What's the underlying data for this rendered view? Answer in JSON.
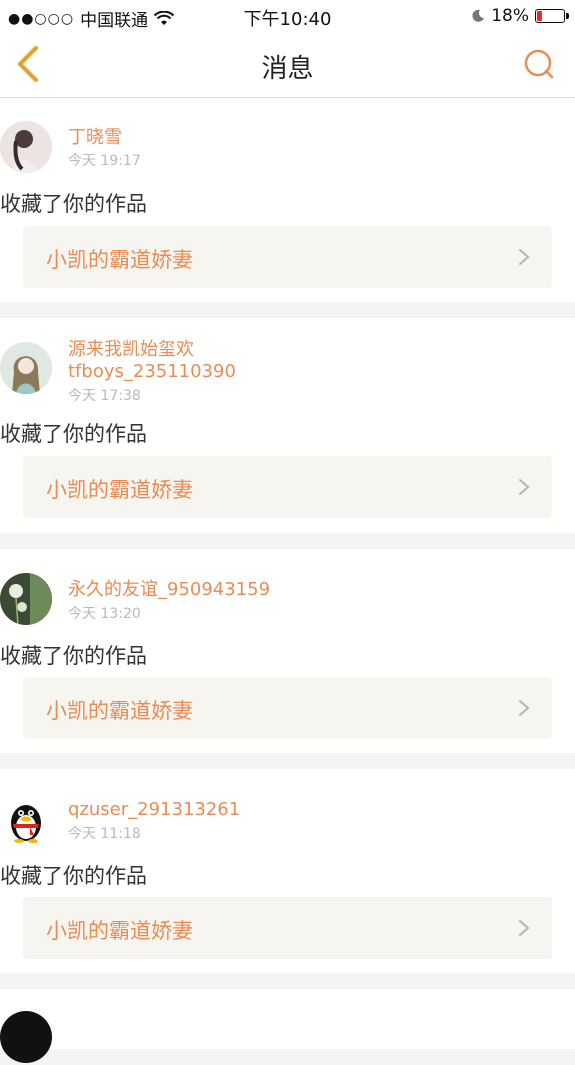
{
  "status_bar": {
    "carrier": "中国联通",
    "time": "下午10:40",
    "battery": "18%",
    "battery_level": 0.18
  },
  "nav": {
    "title": "消息",
    "back_icon": "chevron-left-icon",
    "search_icon": "search-icon"
  },
  "colors": {
    "accent": "#e98c54",
    "work_bg": "#f6f5ef",
    "page_bg": "#f4f4f4"
  },
  "messages": [
    {
      "user": "丁晓雪",
      "time": "今天 19:17",
      "action": "收藏了你的作品",
      "work": "小凯的霸道娇妻"
    },
    {
      "user": "源来我凯始玺欢 tfboys_235110390",
      "user_line1": "源来我凯始玺欢",
      "user_line2": "tfboys_235110390",
      "time": "今天 17:38",
      "action": "收藏了你的作品",
      "work": "小凯的霸道娇妻"
    },
    {
      "user": "永久的友谊_950943159",
      "time": "今天 13:20",
      "action": "收藏了你的作品",
      "work": "小凯的霸道娇妻"
    },
    {
      "user": "qzuser_291313261",
      "time": "今天 11:18",
      "action": "收藏了你的作品",
      "work": "小凯的霸道娇妻"
    }
  ]
}
